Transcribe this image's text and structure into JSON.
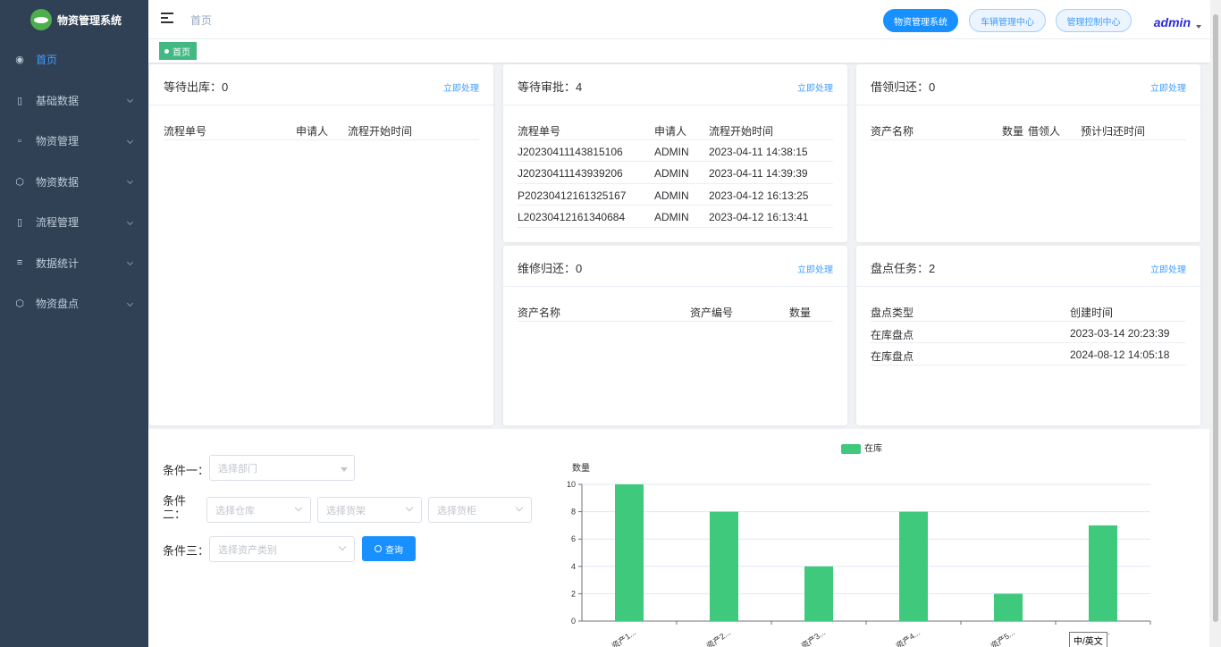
{
  "app": {
    "title": "物资管理系统"
  },
  "sidebar": {
    "items": [
      {
        "label": "首页",
        "icon": "dashboard-icon",
        "active": true
      },
      {
        "label": "基础数据",
        "icon": "book-icon"
      },
      {
        "label": "物资管理",
        "icon": "box-icon"
      },
      {
        "label": "物资数据",
        "icon": "cube-icon"
      },
      {
        "label": "流程管理",
        "icon": "book-icon"
      },
      {
        "label": "数据统计",
        "icon": "chart-icon"
      },
      {
        "label": "物资盘点",
        "icon": "cube-icon"
      }
    ]
  },
  "header": {
    "breadcrumb": "首页",
    "buttons": [
      "物资管理系统",
      "车辆管理中心",
      "管理控制中心"
    ],
    "user": "admin"
  },
  "tags": {
    "active": "首页"
  },
  "cards": {
    "outbound": {
      "title": "等待出库：0",
      "link": "立即处理",
      "columns": [
        "流程单号",
        "申请人",
        "流程开始时间"
      ],
      "rows": []
    },
    "approval": {
      "title": "等待审批：4",
      "link": "立即处理",
      "columns": [
        "流程单号",
        "申请人",
        "流程开始时间"
      ],
      "rows": [
        [
          "J20230411143815106",
          "ADMIN",
          "2023-04-11 14:38:15"
        ],
        [
          "J20230411143939206",
          "ADMIN",
          "2023-04-11 14:39:39"
        ],
        [
          "P20230412161325167",
          "ADMIN",
          "2023-04-12 16:13:25"
        ],
        [
          "L20230412161340684",
          "ADMIN",
          "2023-04-12 16:13:41"
        ]
      ]
    },
    "borrow": {
      "title": "借领归还：0",
      "link": "立即处理",
      "columns": [
        "资产名称",
        "数量",
        "借领人",
        "预计归还时间"
      ],
      "rows": []
    },
    "repair": {
      "title": "维修归还：0",
      "link": "立即处理",
      "columns": [
        "资产名称",
        "资产编号",
        "数量"
      ],
      "rows": []
    },
    "inventory": {
      "title": "盘点任务：2",
      "link": "立即处理",
      "columns": [
        "盘点类型",
        "创建时间"
      ],
      "rows": [
        [
          "在库盘点",
          "2023-03-14 20:23:39"
        ],
        [
          "在库盘点",
          "2024-08-12 14:05:18"
        ]
      ]
    }
  },
  "filters": {
    "cond1_label": "条件一：",
    "cond2_label": "条件二：",
    "cond3_label": "条件三：",
    "dept_placeholder": "选择部门",
    "warehouse_placeholder": "选择仓库",
    "shelf_placeholder": "选择货架",
    "cabinet_placeholder": "选择货柜",
    "category_placeholder": "选择资产类别",
    "query_label": "查询"
  },
  "chart_data": {
    "type": "bar",
    "categories": [
      "资产1...",
      "资产2...",
      "资产3...",
      "资产4...",
      "资产5...",
      "资产6..."
    ],
    "series": [
      {
        "name": "在库",
        "values": [
          10,
          8,
          4,
          8,
          2,
          7
        ],
        "color": "#3ec97c"
      }
    ],
    "ylabel": "数量",
    "ylim": [
      0,
      10
    ],
    "yticks": [
      0,
      2,
      4,
      6,
      8,
      10
    ],
    "legend": "top-center",
    "grid": true
  },
  "ime": {
    "label": "中/英文"
  }
}
